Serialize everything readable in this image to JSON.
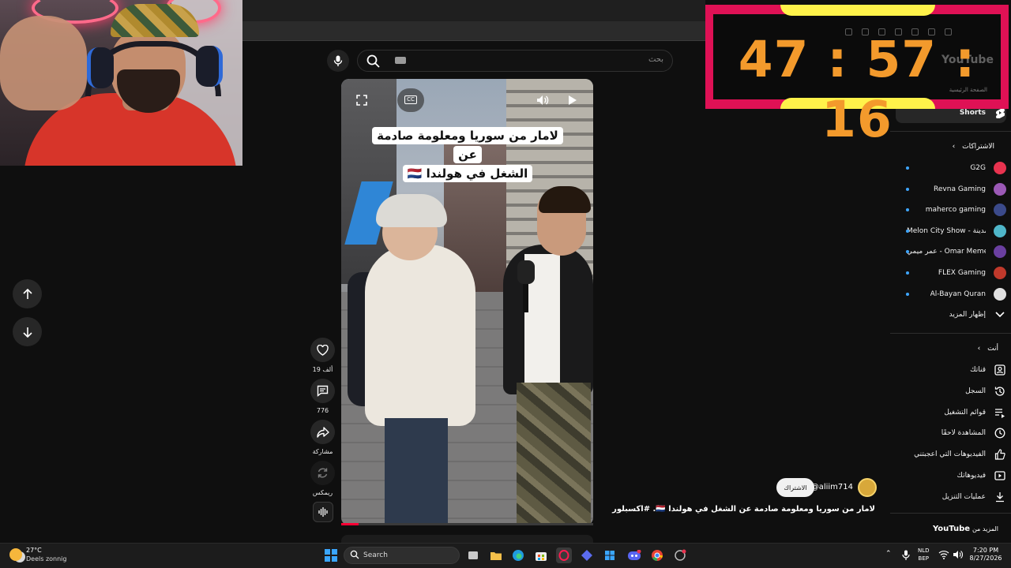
{
  "timer": {
    "display": "47 : 57 : 16"
  },
  "search": {
    "placeholder": "بحث"
  },
  "short": {
    "caption_line1": "لامار من سوريا ومعلومة صادمة عن",
    "caption_line2": "الشغل في هولندا 🇳🇱",
    "title": "لامار من سوريا ومعلومة صادمة عن الشغل في هولندا 🇳🇱. #اكسبلور",
    "channel": "@aliim714",
    "subscribe_label": "الاشتراك",
    "cc_label": "CC",
    "likes": "19 ألف",
    "comments": "776",
    "share_label": "مشاركة",
    "remix_label": "ريمكس",
    "progress": 0.07
  },
  "sidebar": {
    "logo": "YouTube",
    "shorts_label": "Shorts",
    "subscriptions_header": "الاشتراكات",
    "subscriptions": [
      {
        "name": "G2G",
        "color": "#e8334f"
      },
      {
        "name": "Revna Gaming",
        "color": "#9b59b6"
      },
      {
        "name": "maherco gaming",
        "color": "#3b4a8a"
      },
      {
        "name": "Melon City Show - مدينة ...",
        "color": "#4fb6c9"
      },
      {
        "name": "عمر ميمي - Omar Meme",
        "color": "#6a3fa0"
      },
      {
        "name": "FLEX Gaming",
        "color": "#c0392b"
      },
      {
        "name": "Al-Bayan Quran",
        "color": "#e0e0e0"
      }
    ],
    "show_more": "إظهار المزيد",
    "you_header": "أنت",
    "you_items": [
      {
        "label": "قناتك",
        "icon": "person-icon"
      },
      {
        "label": "السجل",
        "icon": "history-icon"
      },
      {
        "label": "قوائم التشغيل",
        "icon": "playlist-icon"
      },
      {
        "label": "المشاهدة لاحقًا",
        "icon": "clock-icon"
      },
      {
        "label": "الفيديوهات التي أعجبتني",
        "icon": "thumb-up-icon"
      },
      {
        "label": "فيديوهاتك",
        "icon": "video-icon"
      },
      {
        "label": "عمليات التنزيل",
        "icon": "download-icon"
      }
    ],
    "more_from_prefix": "المزيد من",
    "more_from_brand": "YouTube",
    "ghost_home": "الصفحة الرئيسية"
  },
  "taskbar": {
    "weather_temp": "27°C",
    "weather_desc": "Deels zonnig",
    "search_label": "Search",
    "lang_top": "NLD",
    "lang_bottom": "BEP",
    "time": "7:20 PM",
    "date": "8/27/2026"
  }
}
